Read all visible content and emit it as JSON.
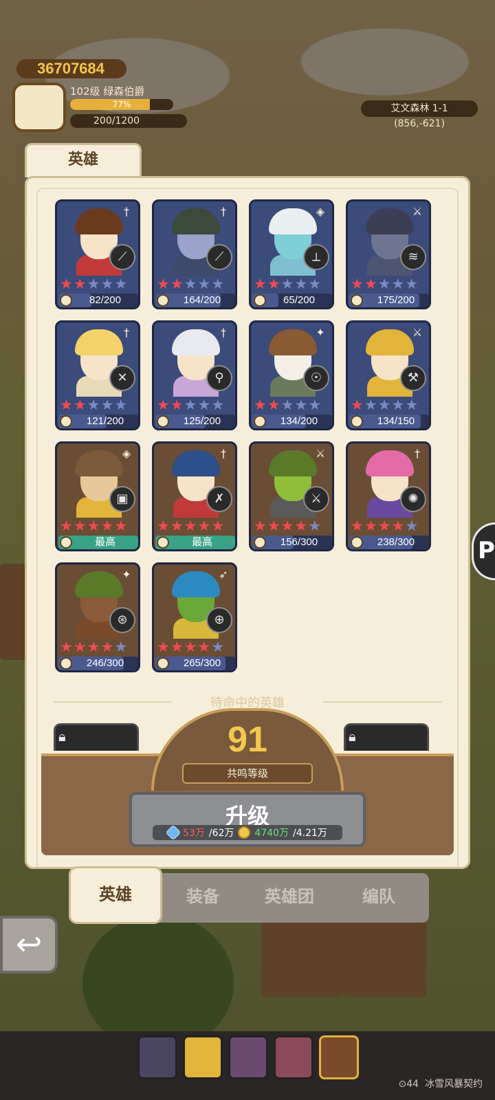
{
  "player": {
    "gold": "36707684",
    "level_name": "102级  绿森伯爵",
    "xp_percent": "77%",
    "xp_fraction": 0.77,
    "stamina": "200/1200"
  },
  "location": {
    "name": "艾文森林 1-1",
    "coords": "(856,-621)"
  },
  "panel": {
    "title": "英雄"
  },
  "heroes": [
    {
      "stars": 2,
      "max_stars": 5,
      "progress": "82/200",
      "fraction": 0.41,
      "type": "sword",
      "weapon": "dagger",
      "skin": "#f6e3c8",
      "hair": "#6b3a1e",
      "body": "#c13a3a",
      "card": "blue"
    },
    {
      "stars": 2,
      "max_stars": 5,
      "progress": "164/200",
      "fraction": 0.82,
      "type": "sword",
      "weapon": "dagger",
      "skin": "#9aa3c9",
      "hair": "#3b4a3a",
      "body": "#3d4a6a",
      "card": "blue"
    },
    {
      "stars": 2,
      "max_stars": 5,
      "progress": "65/200",
      "fraction": 0.325,
      "type": "shield",
      "weapon": "bone",
      "skin": "#7fd0d6",
      "hair": "#e9eef0",
      "body": "#7fc0d0",
      "card": "blue"
    },
    {
      "stars": 2,
      "max_stars": 5,
      "progress": "175/200",
      "fraction": 0.875,
      "type": "axe",
      "weapon": "claw",
      "skin": "#6d7590",
      "hair": "#3a3f55",
      "body": "#4e5570",
      "card": "blue"
    },
    {
      "stars": 2,
      "max_stars": 5,
      "progress": "121/200",
      "fraction": 0.605,
      "type": "sword",
      "weapon": "crossed-swords",
      "skin": "#f6e3c8",
      "hair": "#f2d269",
      "body": "#e8d9b8",
      "card": "blue"
    },
    {
      "stars": 2,
      "max_stars": 5,
      "progress": "125/200",
      "fraction": 0.625,
      "type": "sword",
      "weapon": "wand",
      "skin": "#f6e3c8",
      "hair": "#e9e9f0",
      "body": "#c8a6d8",
      "card": "blue"
    },
    {
      "stars": 2,
      "max_stars": 5,
      "progress": "134/200",
      "fraction": 0.67,
      "type": "magic",
      "weapon": "staff",
      "skin": "#f3efe6",
      "hair": "#8a5a32",
      "body": "#6a7a5a",
      "card": "blue"
    },
    {
      "stars": 1,
      "max_stars": 5,
      "progress": "134/150",
      "fraction": 0.893,
      "type": "axe",
      "weapon": "hammer",
      "skin": "#f6e3c8",
      "hair": "#e2b43a",
      "body": "#e2b43a",
      "card": "blue"
    },
    {
      "stars": 5,
      "max_stars": 5,
      "progress": "最高",
      "fraction": 1,
      "type": "shield",
      "weapon": "barrel",
      "skin": "#e6c89a",
      "hair": "#7a5a3a",
      "body": "#e2b43a",
      "card": "brown",
      "max": true
    },
    {
      "stars": 5,
      "max_stars": 5,
      "progress": "最高",
      "fraction": 1,
      "type": "sword",
      "weapon": "crossed-daggers",
      "skin": "#f6e3c8",
      "hair": "#2d4f8a",
      "body": "#c13a3a",
      "card": "brown",
      "max": true
    },
    {
      "stars": 4,
      "max_stars": 5,
      "progress": "156/300",
      "fraction": 0.52,
      "type": "axe",
      "weapon": "axe",
      "skin": "#8fbf3a",
      "hair": "#5a7a2a",
      "body": "#5a5a5a",
      "card": "brown"
    },
    {
      "stars": 4,
      "max_stars": 5,
      "progress": "238/300",
      "fraction": 0.793,
      "type": "sword",
      "weapon": "mace",
      "skin": "#f6e3c8",
      "hair": "#e56aa8",
      "body": "#6a4aa0",
      "card": "brown"
    },
    {
      "stars": 4,
      "max_stars": 5,
      "progress": "246/300",
      "fraction": 0.82,
      "type": "magic",
      "weapon": "cannon",
      "skin": "#8a5a3a",
      "hair": "#5a7a2a",
      "body": "#7a4a2a",
      "card": "brown"
    },
    {
      "stars": 4,
      "max_stars": 5,
      "progress": "265/300",
      "fraction": 0.883,
      "type": "bow",
      "weapon": "gun",
      "skin": "#6aa83a",
      "hair": "#2d8ac0",
      "body": "#d8b83a",
      "card": "brown"
    }
  ],
  "waiting_label": "待命中的英雄",
  "resonance": {
    "level": "91",
    "label": "共鸣等级"
  },
  "upgrade": {
    "label": "升级",
    "cost1_have": "53万",
    "cost1_need": "/62万",
    "cost2_have": "4740万",
    "cost2_need": "/4.21万"
  },
  "tabs": [
    "英雄",
    "装备",
    "英雄团",
    "编队"
  ],
  "active_tab": "英雄",
  "back_icon": "back-arrow-icon",
  "footer": {
    "power": "44",
    "watermark": "冰雪风暴契约"
  },
  "colors": {
    "star_on": "#f04b52",
    "star_off": "#7a8bc4",
    "max_bar": "#3aa287",
    "accent": "#f2c94c"
  }
}
